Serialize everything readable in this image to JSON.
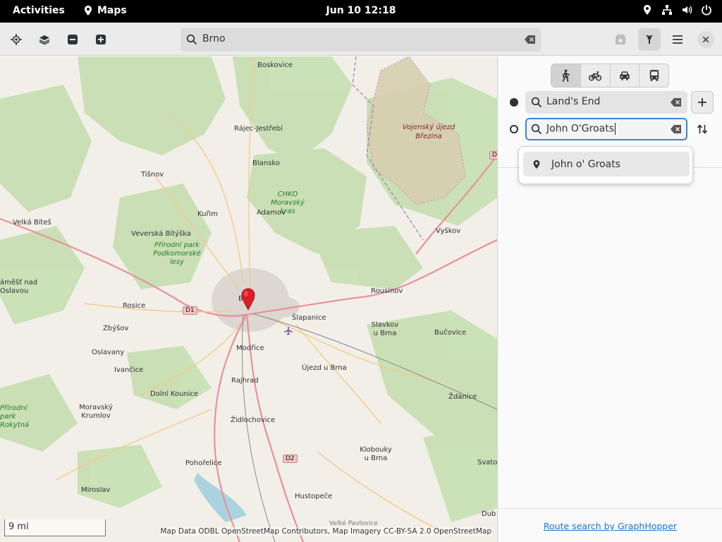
{
  "topbar": {
    "activities": "Activities",
    "app_name": "Maps",
    "clock": "Jun 10  12:18"
  },
  "header": {
    "search_value": "Brno"
  },
  "map": {
    "labels": [
      {
        "text": "Boskovice",
        "cls": ""
      },
      {
        "text": "Rájec-Jestřebí",
        "cls": ""
      },
      {
        "text": "Blansko",
        "cls": ""
      },
      {
        "text": "Tišnov",
        "cls": ""
      },
      {
        "text": "CHKO Moravský kras",
        "cls": "green"
      },
      {
        "text": "Kuřim",
        "cls": ""
      },
      {
        "text": "Adamov",
        "cls": ""
      },
      {
        "text": "Velká Bíteš",
        "cls": ""
      },
      {
        "text": "Veverská Bítýška",
        "cls": ""
      },
      {
        "text": "Přírodní park Podkomorské lesy",
        "cls": "green"
      },
      {
        "text": "Vyškov",
        "cls": ""
      },
      {
        "text": "Vojenský újezd Březina",
        "cls": "red"
      },
      {
        "text": "áměšť nad Oslavou",
        "cls": ""
      },
      {
        "text": "Rosice",
        "cls": ""
      },
      {
        "text": "Brno",
        "cls": ""
      },
      {
        "text": "Šlapanice",
        "cls": ""
      },
      {
        "text": "Rousínov",
        "cls": ""
      },
      {
        "text": "Zbýšov",
        "cls": ""
      },
      {
        "text": "Slavkov u Brna",
        "cls": ""
      },
      {
        "text": "Bučovice",
        "cls": ""
      },
      {
        "text": "Oslavany",
        "cls": ""
      },
      {
        "text": "Modřice",
        "cls": ""
      },
      {
        "text": "Ivančice",
        "cls": ""
      },
      {
        "text": "Újezd u Brna",
        "cls": ""
      },
      {
        "text": "Rajhrad",
        "cls": ""
      },
      {
        "text": "Dolní Kounice",
        "cls": ""
      },
      {
        "text": "Ždánice",
        "cls": ""
      },
      {
        "text": "Přírodní park Rokytná",
        "cls": "green"
      },
      {
        "text": "Moravský Krumlov",
        "cls": ""
      },
      {
        "text": "Židlochovice",
        "cls": ""
      },
      {
        "text": "Klobouky u Brna",
        "cls": ""
      },
      {
        "text": "Pohořelice",
        "cls": ""
      },
      {
        "text": "Svatob",
        "cls": ""
      },
      {
        "text": "Miroslav",
        "cls": ""
      },
      {
        "text": "Hustopeče",
        "cls": ""
      },
      {
        "text": "Dub",
        "cls": ""
      },
      {
        "text": "Velké Pavlovice",
        "cls": ""
      }
    ],
    "shields": [
      "D1",
      "D2",
      "D"
    ],
    "scale": "9 mi",
    "attribution": "Map Data ODBL OpenStreetMap Contributors, Map Imagery CC-BY-SA 2.0 OpenStreetMap"
  },
  "route": {
    "from_value": "Land's End",
    "to_value": "John O'Groats",
    "suggestion": "John o' Groats",
    "footer_link": "Route search by GraphHopper"
  },
  "colors": {
    "accent": "#3584e4",
    "link": "#1c71d8",
    "pin": "#e01b24"
  }
}
